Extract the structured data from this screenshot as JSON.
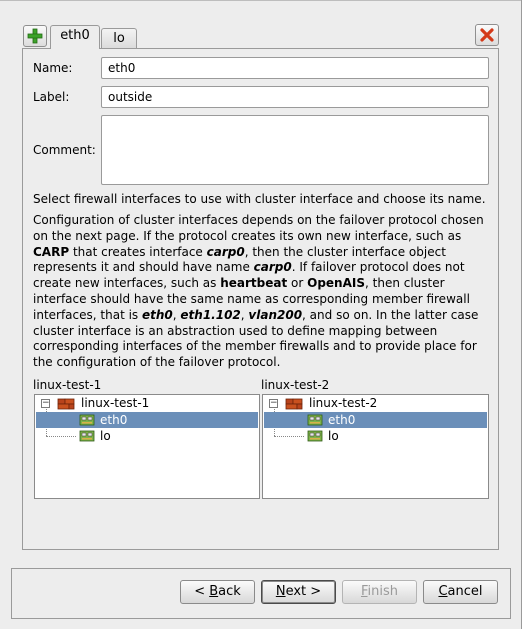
{
  "tabs": [
    {
      "label": "eth0",
      "active": true
    },
    {
      "label": "lo",
      "active": false
    }
  ],
  "form": {
    "name_label": "Name:",
    "name_value": "eth0",
    "label_label": "Label:",
    "label_value": "outside",
    "comment_label": "Comment:",
    "comment_value": ""
  },
  "intro_text": "Select firewall interfaces to use with cluster interface and choose its name.",
  "description": {
    "t1": "Configuration of cluster interfaces depends on the failover protocol chosen on the next page. If the protocol creates its own new interface, such as ",
    "carp": "CARP",
    "t2": " that creates interface ",
    "carp0": "carp0",
    "t3": ", then the cluster interface object represents it and should have name ",
    "carp0b": "carp0",
    "t4": ". If failover protocol does not create new interfaces, such as ",
    "heartbeat": "heartbeat",
    "t5": " or ",
    "openais": "OpenAIS",
    "t6": ", then cluster interface should have the same name as corresponding member firewall interfaces, that is ",
    "eth0": "eth0",
    "t7": ", ",
    "eth1102": "eth1.102",
    "t8": ", ",
    "vlan200": "vlan200",
    "t9": ", and so on. In the latter case cluster interface is an abstraction used to define mapping between corresponding interfaces of the member firewalls and to provide place for the configuration of the failover protocol."
  },
  "trees": [
    {
      "title": "linux-test-1",
      "root": "linux-test-1",
      "items": [
        "eth0",
        "lo"
      ],
      "selected": "eth0"
    },
    {
      "title": "linux-test-2",
      "root": "linux-test-2",
      "items": [
        "eth0",
        "lo"
      ],
      "selected": "eth0"
    }
  ],
  "buttons": {
    "back_pre": "< ",
    "back_u": "B",
    "back_post": "ack",
    "next_u": "N",
    "next_post": "ext >",
    "finish_u": "F",
    "finish_post": "inish",
    "cancel_u": "C",
    "cancel_post": "ancel"
  },
  "colors": {
    "selection": "#6b8fb9",
    "add_icon": "#3da22a",
    "close_icon": "#d43a1a"
  }
}
